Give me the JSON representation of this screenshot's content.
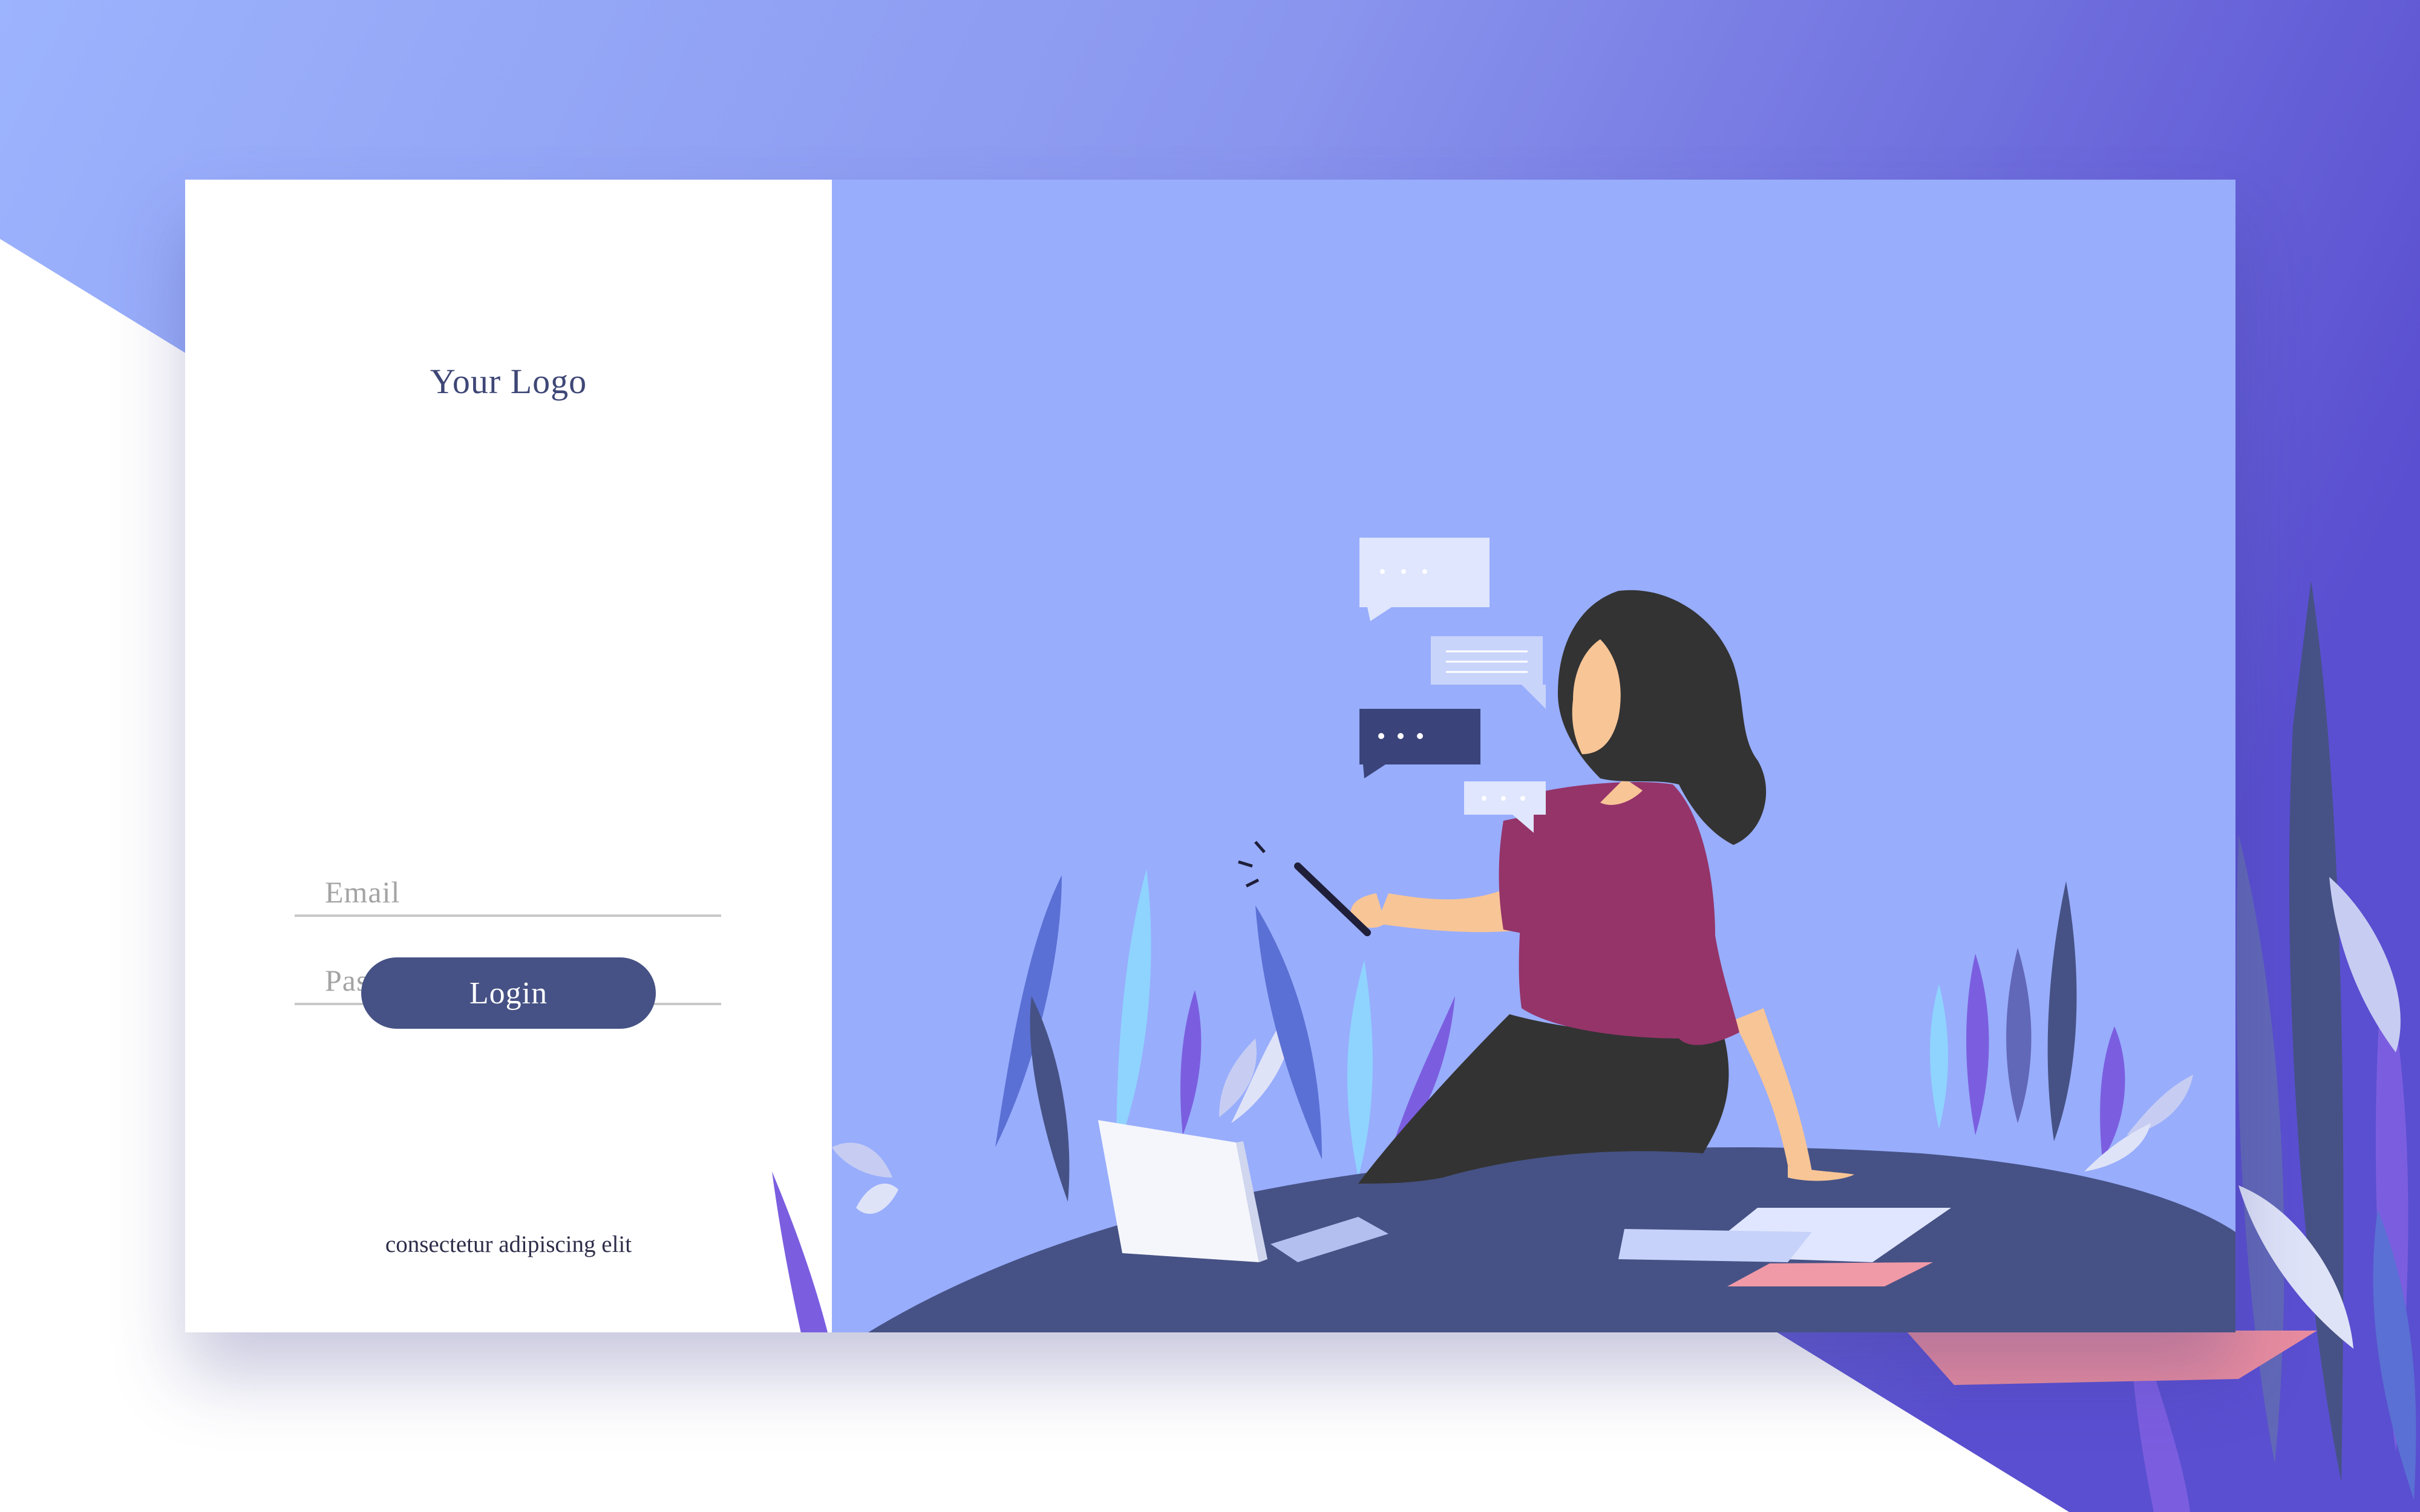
{
  "login_panel": {
    "logo_text": "Your Logo",
    "email_placeholder": "Email",
    "password_placeholder": "Password",
    "login_label": "Login",
    "footer_text": "consectetur adipiscing elit"
  },
  "colors": {
    "gradient_start": "#9cb3fd",
    "gradient_end": "#5a4fd0",
    "scene_bg": "#98adfc",
    "button": "#465285",
    "ground": "#465285",
    "shirt": "#953469",
    "hair": "#333333",
    "skin": "#f8c596"
  },
  "illustration": {
    "subject": "woman sitting on a hill using a smartphone",
    "chat_bubbles": [
      "light-dots-bubble",
      "lines-bubble",
      "dark-dots-bubble",
      "small-dots-bubble"
    ]
  }
}
